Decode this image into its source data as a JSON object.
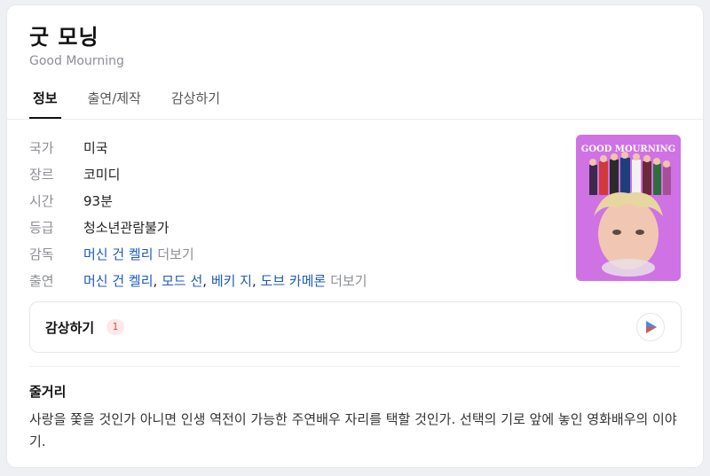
{
  "header": {
    "title": "굿 모닝",
    "subtitle": "Good Mourning"
  },
  "tabs": [
    {
      "label": "정보"
    },
    {
      "label": "출연/제작"
    },
    {
      "label": "감상하기"
    }
  ],
  "info": {
    "country": {
      "label": "국가",
      "value": "미국"
    },
    "genre": {
      "label": "장르",
      "value": "코미디"
    },
    "runtime": {
      "label": "시간",
      "value": "93분"
    },
    "rating": {
      "label": "등급",
      "value": "청소년관람불가"
    },
    "director": {
      "label": "감독",
      "name": "머신 건 켈리",
      "more": "더보기"
    },
    "cast": {
      "label": "출연",
      "names": [
        "머신 건 켈리",
        "모드 선",
        "베키 지",
        "도브 카메론"
      ],
      "separator": ", ",
      "more": "더보기"
    }
  },
  "poster": {
    "title_text": "GOOD MOURNING",
    "colors": {
      "background": "#c96be0",
      "hair": "#e8d6a0",
      "skin": "#f1c7b4"
    }
  },
  "watch": {
    "label": "감상하기",
    "count": "1",
    "icon": "play-triangle-icon"
  },
  "plot": {
    "title": "줄거리",
    "text": "사랑을 쫓을 것인가 아니면 인생 역전이 가능한 주연배우 자리를 택할 것인가. 선택의 기로 앞에 놓인 영화배우의 이야기."
  },
  "colors": {
    "link": "#1d5bbf",
    "muted": "#8c8f94",
    "badge_bg": "#fde9e9",
    "badge_text": "#e5484d"
  }
}
